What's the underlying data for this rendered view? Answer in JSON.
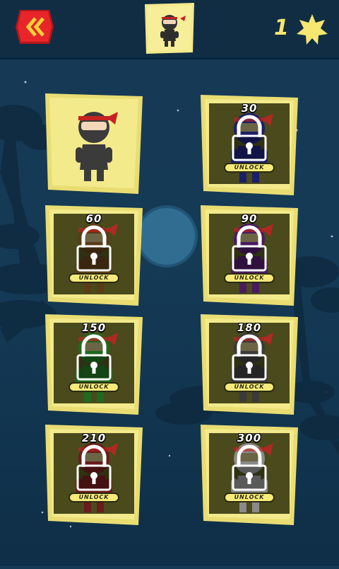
{
  "header": {
    "back_icon": "double-chevron-left-icon",
    "star_count": "1",
    "star_icon": "star-icon"
  },
  "colors": {
    "accent_red": "#e8262a",
    "card_yellow": "#f3ea8c",
    "locked_inner": "#4a4a1c",
    "star_yellow": "#f6e770"
  },
  "characters": [
    {
      "price": "",
      "locked": false,
      "color": "#3b3b3b"
    },
    {
      "price": "30",
      "locked": true,
      "color": "#1b1f6a",
      "unlock_label": "UNLOCK"
    },
    {
      "price": "60",
      "locked": true,
      "color": "#5a3b18",
      "unlock_label": "UNLOCK"
    },
    {
      "price": "90",
      "locked": true,
      "color": "#4a1b60",
      "unlock_label": "UNLOCK"
    },
    {
      "price": "150",
      "locked": true,
      "color": "#1f6a1f",
      "unlock_label": "UNLOCK"
    },
    {
      "price": "180",
      "locked": true,
      "color": "#3a3a3a",
      "unlock_label": "UNLOCK"
    },
    {
      "price": "210",
      "locked": true,
      "color": "#6a1b1b",
      "unlock_label": "UNLOCK"
    },
    {
      "price": "300",
      "locked": true,
      "color": "#8a8a8a",
      "unlock_label": "UNLOCK"
    }
  ]
}
